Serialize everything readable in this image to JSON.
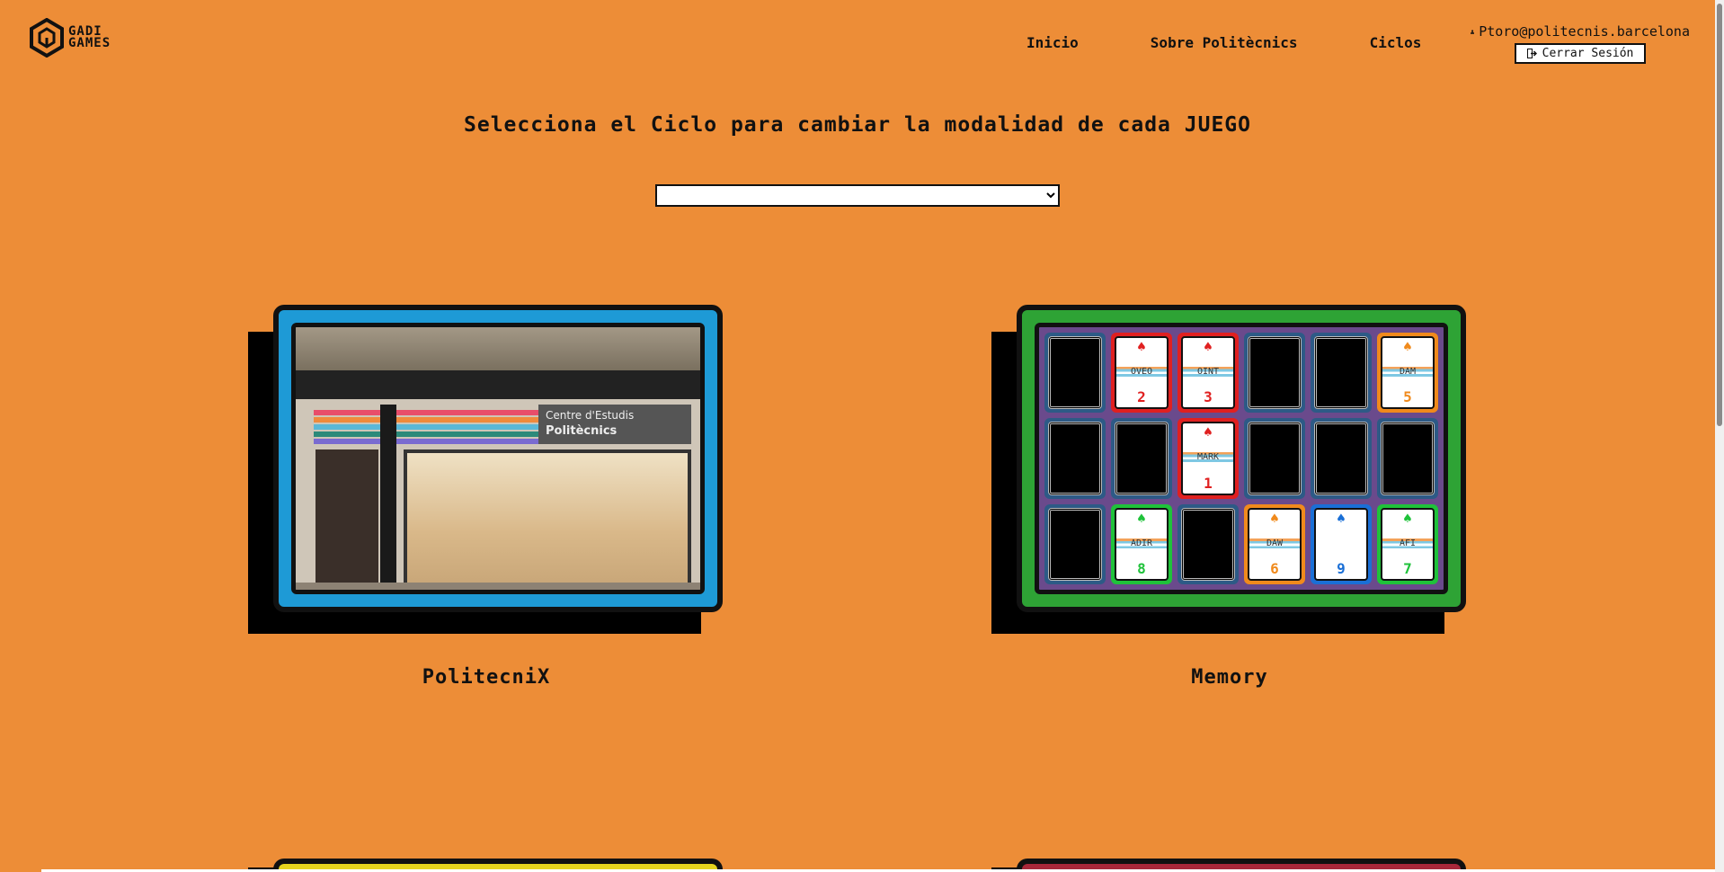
{
  "header": {
    "logo_text_line1": "GADI",
    "logo_text_line2": "GAMES",
    "nav": [
      {
        "label": "Inicio"
      },
      {
        "label": "Sobre Politècnics"
      },
      {
        "label": "Ciclos"
      }
    ],
    "user_email": "Ptoro@politecnis.barcelona",
    "logout_label": "Cerrar Sesión"
  },
  "main": {
    "heading": "Selecciona el Ciclo para cambiar la modalidad de cada JUEGO",
    "cycle_select_value": "",
    "games": [
      {
        "title": "PolitecniX",
        "frame_color": "#1e9ad6",
        "sign_line1": "Centre d'Estudis",
        "sign_line2": "Politècnics"
      },
      {
        "title": "Memory",
        "frame_color": "#2ea335"
      }
    ],
    "memory_cards": [
      {
        "face": "down"
      },
      {
        "face": "up",
        "code": "OVEO",
        "num": "2",
        "color": "#e02020"
      },
      {
        "face": "up",
        "code": "OINT",
        "num": "3",
        "color": "#e02020"
      },
      {
        "face": "down"
      },
      {
        "face": "down"
      },
      {
        "face": "up",
        "code": "DAM",
        "num": "5",
        "color": "#f08a1c"
      },
      {
        "face": "down"
      },
      {
        "face": "down"
      },
      {
        "face": "up",
        "code": "MARK",
        "num": "1",
        "color": "#e02020"
      },
      {
        "face": "down"
      },
      {
        "face": "down"
      },
      {
        "face": "down"
      },
      {
        "face": "down"
      },
      {
        "face": "up",
        "code": "ADIR",
        "num": "8",
        "color": "#1fc23a"
      },
      {
        "face": "down"
      },
      {
        "face": "up",
        "code": "DAW",
        "num": "6",
        "color": "#f08a1c"
      },
      {
        "face": "up",
        "code": "",
        "num": "9",
        "color": "#1a6fd6"
      },
      {
        "face": "up",
        "code": "AFI",
        "num": "7",
        "color": "#1fc23a"
      }
    ],
    "bottom_frames": [
      {
        "frame_color": "#e6d41e"
      },
      {
        "frame_color": "#a8283a"
      }
    ]
  }
}
